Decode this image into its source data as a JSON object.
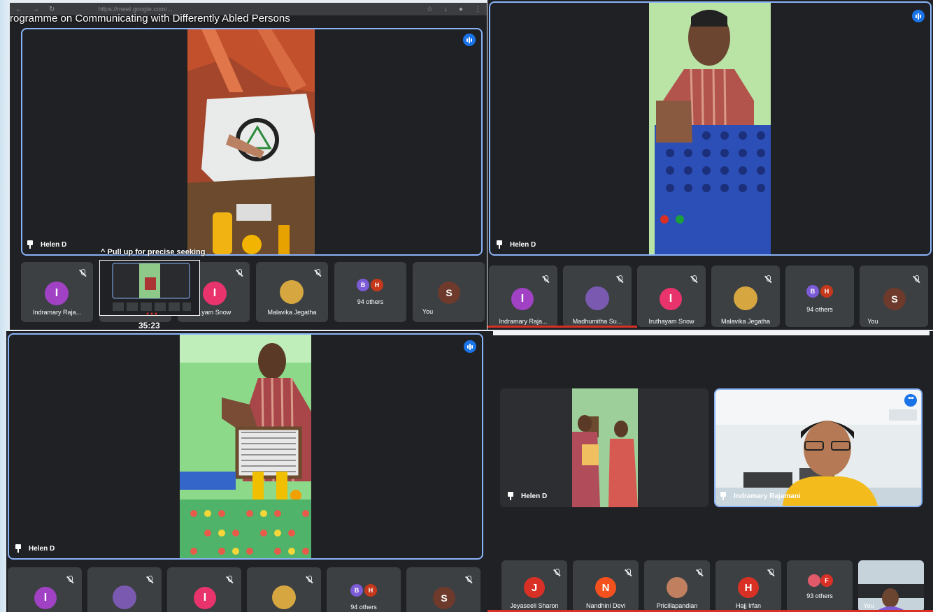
{
  "panel1": {
    "browser_url": "https://meet.google.com/...",
    "caption": "rogramme on Communicating with Differently Abled Persons",
    "pinned_name": "Helen D",
    "seek_hint": "^ Pull up for precise seeking",
    "seek_time": "35:23",
    "tiles": [
      {
        "initial": "I",
        "color": "#a142c4",
        "label": "Indramary Raja..."
      },
      {
        "initial": "",
        "color": "#000",
        "label": ""
      },
      {
        "initial": "I",
        "color": "#e8336d",
        "label": "...yam Snow"
      },
      {
        "initial": "",
        "color": "#d6a641",
        "label": "Malavika Jegatha"
      },
      {
        "mini1": "B",
        "mini2": "H",
        "label": "94 others"
      },
      {
        "initial": "S",
        "color": "#6d3a2c",
        "label": "You"
      }
    ]
  },
  "panel2": {
    "pinned_name": "Helen D",
    "tiles": [
      {
        "initial": "I",
        "color": "#a142c4",
        "label": "Indramary Raja..."
      },
      {
        "initial": "",
        "color": "#7a5ab0",
        "label": "Madhumitha Su..."
      },
      {
        "initial": "I",
        "color": "#e8336d",
        "label": "Iruthayam Snow"
      },
      {
        "initial": "",
        "color": "#d6a641",
        "label": "Malavika Jegatha"
      },
      {
        "mini1": "B",
        "mini2": "H",
        "label": "94 others"
      },
      {
        "initial": "S",
        "color": "#6d3a2c",
        "label": "You"
      }
    ]
  },
  "panel3": {
    "pinned_name": "Helen D",
    "tiles": [
      {
        "initial": "I",
        "color": "#a142c4",
        "label": ""
      },
      {
        "initial": "",
        "color": "#7a5ab0",
        "label": ""
      },
      {
        "initial": "I",
        "color": "#e8336d",
        "label": ""
      },
      {
        "initial": "",
        "color": "#d6a641",
        "label": ""
      },
      {
        "mini1": "B",
        "mini2": "H",
        "label": "94 others"
      },
      {
        "initial": "S",
        "color": "#6d3a2c",
        "label": ""
      }
    ]
  },
  "panel4": {
    "left_name": "Helen D",
    "right_name": "Indramary Rajamani",
    "tiles": [
      {
        "initial": "J",
        "color": "#d93025",
        "label": "Jeyaseeli Sharon"
      },
      {
        "initial": "N",
        "color": "#f4511e",
        "label": "Nandhini Devi"
      },
      {
        "initial": "",
        "color": "#c08060",
        "label": "Pricillapandian"
      },
      {
        "initial": "H",
        "color": "#d93025",
        "label": "Hajj Irfan"
      },
      {
        "mini1": "",
        "mini2": "F",
        "label": "93 others"
      },
      {
        "initial": "",
        "color": "#556",
        "label": "You"
      }
    ]
  }
}
